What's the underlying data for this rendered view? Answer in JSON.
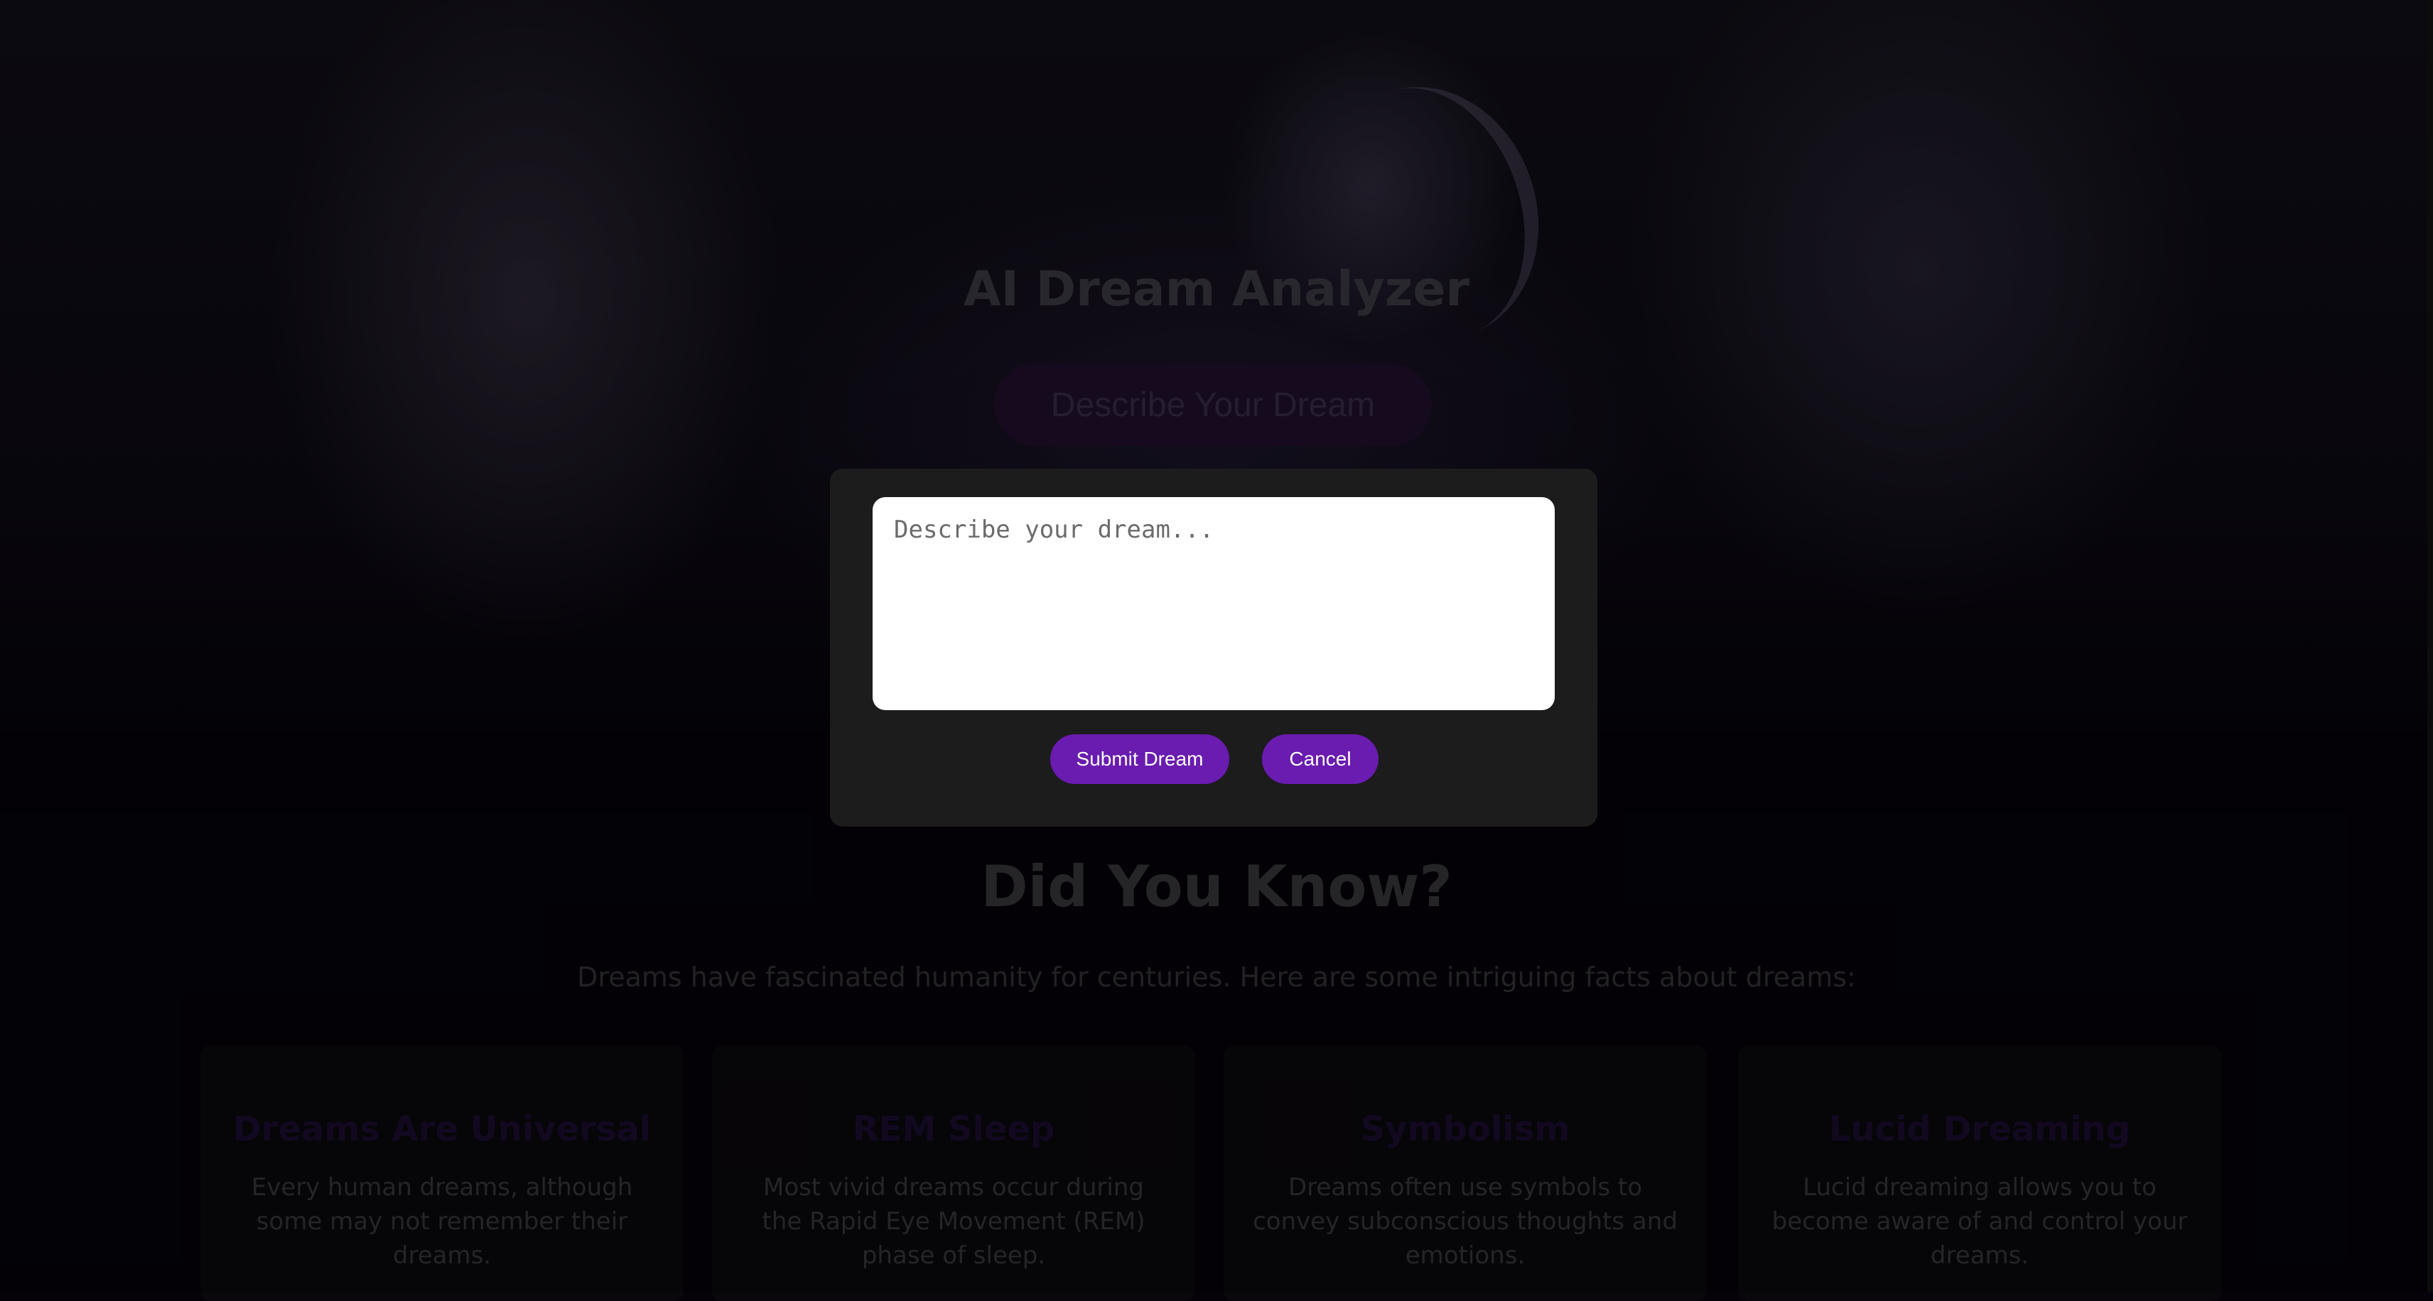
{
  "hero": {
    "title": "AI Dream Analyzer",
    "cta_label": "Describe Your Dream"
  },
  "facts": {
    "title": "Did You Know?",
    "intro": "Dreams have fascinated humanity for centuries. Here are some intriguing facts about dreams:",
    "cards": [
      {
        "title": "Dreams Are Universal",
        "text": "Every human dreams, although some may not remember their dreams."
      },
      {
        "title": "REM Sleep",
        "text": "Most vivid dreams occur during the Rapid Eye Movement (REM) phase of sleep."
      },
      {
        "title": "Symbolism",
        "text": "Dreams often use symbols to convey subconscious thoughts and emotions."
      },
      {
        "title": "Lucid Dreaming",
        "text": "Lucid dreaming allows you to become aware of and control your dreams."
      }
    ]
  },
  "modal": {
    "input_placeholder": "Describe your dream...",
    "input_value": "",
    "submit_label": "Submit Dream",
    "cancel_label": "Cancel"
  },
  "colors": {
    "accent": "#6a1bb0",
    "modal_bg": "#1c1c1c",
    "page_bg": "#050309"
  }
}
